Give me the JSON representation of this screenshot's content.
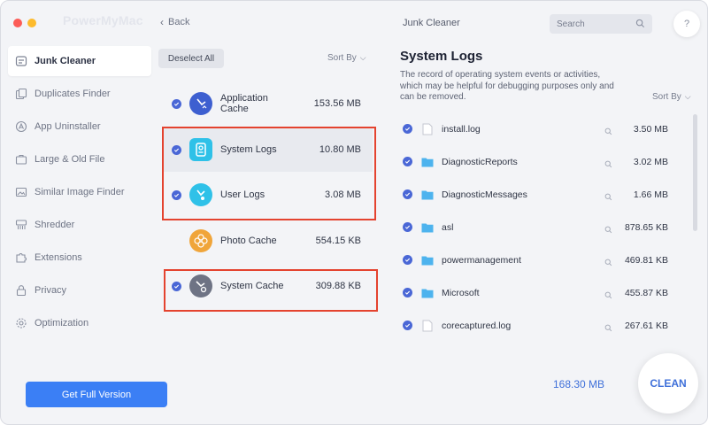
{
  "app": {
    "title": "PowerMyMac"
  },
  "sidebar": {
    "items": [
      {
        "label": "Junk Cleaner",
        "icon": "broom-icon",
        "active": true
      },
      {
        "label": "Duplicates Finder",
        "icon": "duplicate-icon"
      },
      {
        "label": "App Uninstaller",
        "icon": "uninstall-icon"
      },
      {
        "label": "Large & Old File",
        "icon": "briefcase-icon"
      },
      {
        "label": "Similar Image Finder",
        "icon": "image-icon"
      },
      {
        "label": "Shredder",
        "icon": "shredder-icon"
      },
      {
        "label": "Extensions",
        "icon": "extension-icon"
      },
      {
        "label": "Privacy",
        "icon": "lock-icon"
      },
      {
        "label": "Optimization",
        "icon": "gear-icon"
      }
    ],
    "full_version_label": "Get Full Version"
  },
  "middle": {
    "back_label": "Back",
    "deselect_label": "Deselect All",
    "sort_label": "Sort By",
    "categories": [
      {
        "label": "Application Cache",
        "size": "153.56 MB",
        "icon": "app-cache-icon",
        "color": "#3d5fd0"
      },
      {
        "label": "System Logs",
        "size": "10.80 MB",
        "icon": "system-logs-icon",
        "color": "#2fc1e8",
        "selected": true
      },
      {
        "label": "User Logs",
        "size": "3.08 MB",
        "icon": "user-logs-icon",
        "color": "#2fc1e8"
      },
      {
        "label": "Photo Cache",
        "size": "554.15 KB",
        "icon": "photo-cache-icon",
        "color": "#f0a53a"
      },
      {
        "label": "System Cache",
        "size": "309.88 KB",
        "icon": "system-cache-icon",
        "color": "#6e7384"
      }
    ]
  },
  "right": {
    "top_title": "Junk Cleaner",
    "search_placeholder": "Search",
    "help_label": "?",
    "section_title": "System Logs",
    "section_desc": "The record of operating system events or activities, which may be helpful for debugging purposes only and can be removed.",
    "sort_label": "Sort By",
    "files": [
      {
        "name": "install.log",
        "size": "3.50 MB",
        "type": "file"
      },
      {
        "name": "DiagnosticReports",
        "size": "3.02 MB",
        "type": "folder"
      },
      {
        "name": "DiagnosticMessages",
        "size": "1.66 MB",
        "type": "folder"
      },
      {
        "name": "asl",
        "size": "878.65 KB",
        "type": "folder"
      },
      {
        "name": "powermanagement",
        "size": "469.81 KB",
        "type": "folder"
      },
      {
        "name": "Microsoft",
        "size": "455.87 KB",
        "type": "folder"
      },
      {
        "name": "corecaptured.log",
        "size": "267.61 KB",
        "type": "file"
      }
    ],
    "total": "168.30 MB",
    "clean_label": "CLEAN"
  },
  "colors": {
    "accent": "#3b7ff5",
    "check": "#4a67d6",
    "highlight": "#e4432f",
    "folder": "#4db3ee"
  }
}
